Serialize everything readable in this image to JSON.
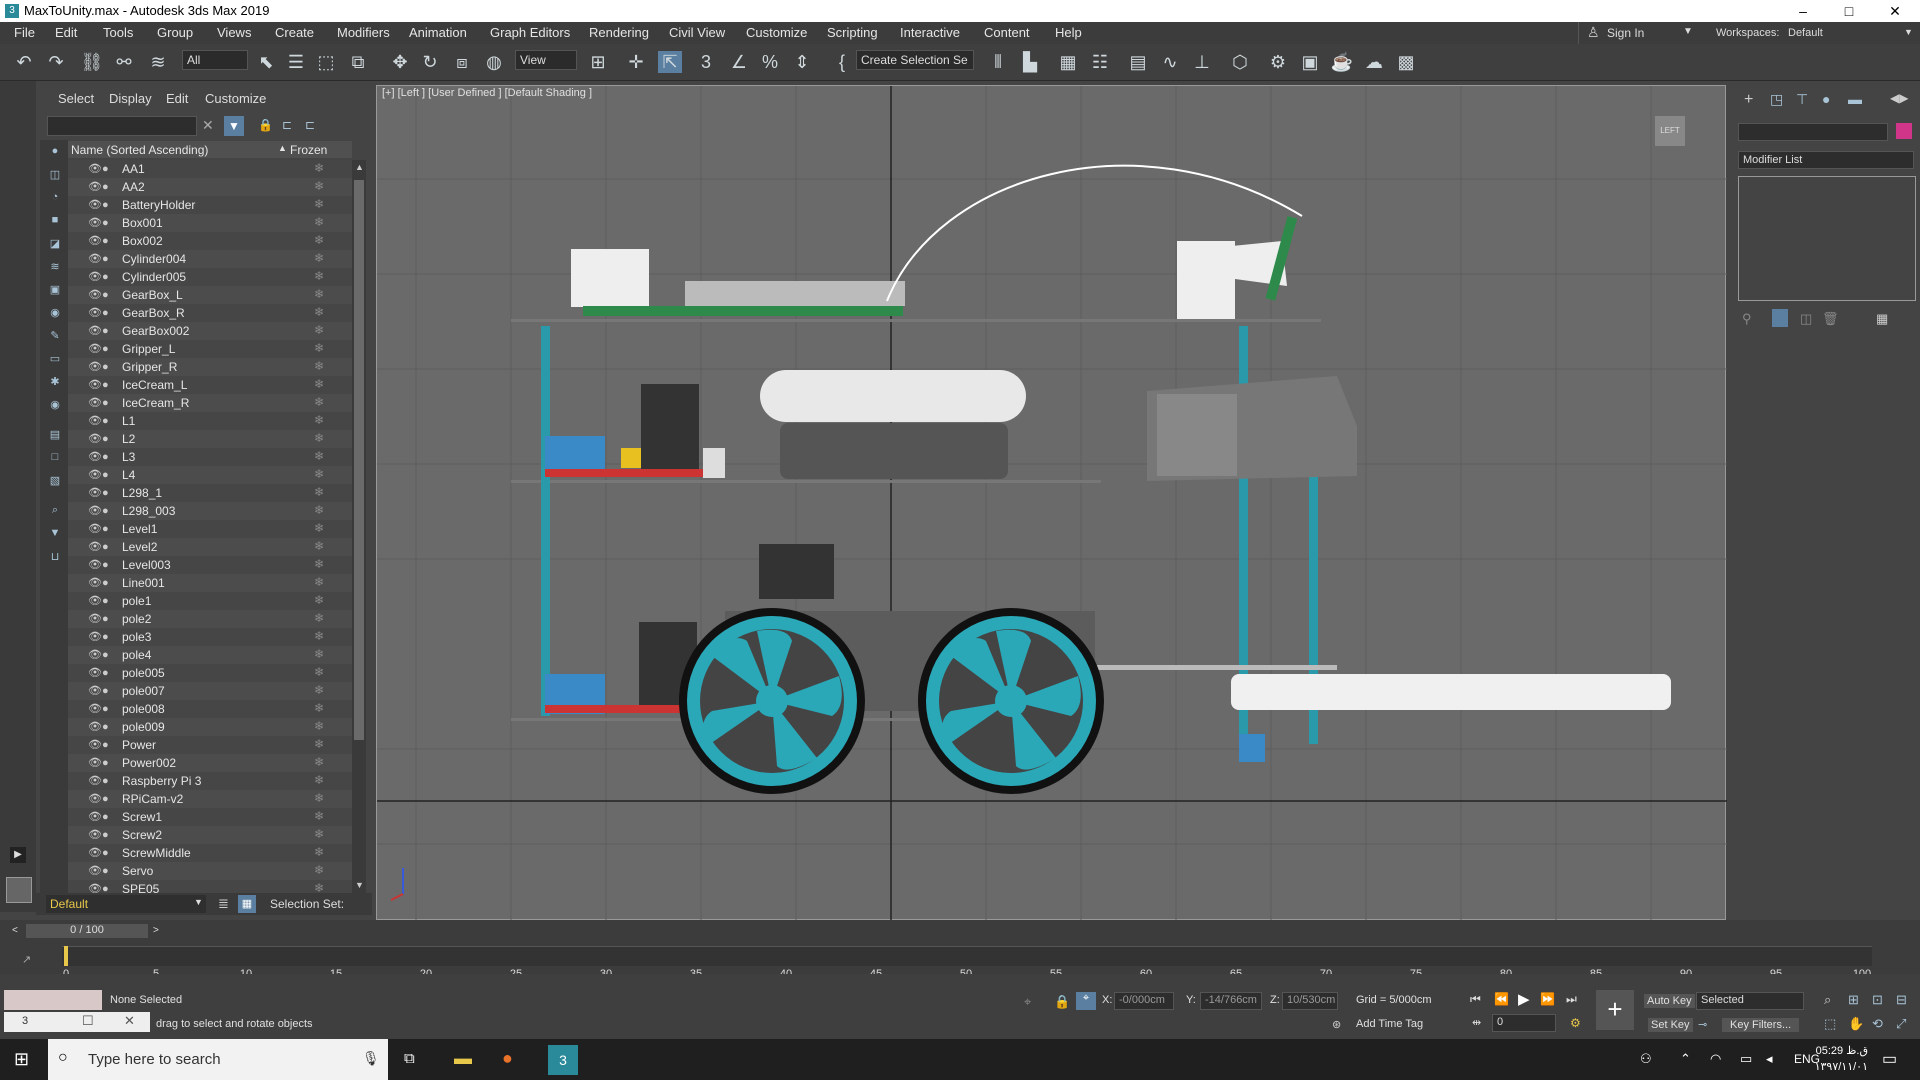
{
  "window": {
    "title": "MaxToUnity.max - Autodesk 3ds Max 2019",
    "min": "–",
    "max": "□",
    "close": "✕"
  },
  "menu": [
    "File",
    "Edit",
    "Tools",
    "Group",
    "Views",
    "Create",
    "Modifiers",
    "Animation",
    "Graph Editors",
    "Rendering",
    "Civil View",
    "Customize",
    "Scripting",
    "Interactive",
    "Content",
    "Help"
  ],
  "signin": "Sign In",
  "workspaces_label": "Workspaces:",
  "workspace": "Default",
  "toolbar": {
    "filter": "All",
    "refcoord": "View",
    "selset": "Create Selection Se"
  },
  "explorer": {
    "tabs": [
      "Select",
      "Display",
      "Edit",
      "Customize"
    ],
    "col_name": "Name (Sorted Ascending)",
    "col_frozen": "Frozen",
    "items": [
      "AA1",
      "AA2",
      "BatteryHolder",
      "Box001",
      "Box002",
      "Cylinder004",
      "Cylinder005",
      "GearBox_L",
      "GearBox_R",
      "GearBox002",
      "Gripper_L",
      "Gripper_R",
      "IceCream_L",
      "IceCream_R",
      "L1",
      "L2",
      "L3",
      "L4",
      "L298_1",
      "L298_003",
      "Level1",
      "Level2",
      "Level003",
      "Line001",
      "pole1",
      "pole2",
      "pole3",
      "pole4",
      "pole005",
      "pole007",
      "pole008",
      "pole009",
      "Power",
      "Power002",
      "Raspberry Pi 3",
      "RPiCam-v2",
      "Screw1",
      "Screw2",
      "ScrewMiddle",
      "Servo",
      "SPE05"
    ],
    "layer": "Default",
    "selection_set": "Selection Set:"
  },
  "viewport": {
    "label": "[+] [Left ] [User Defined ] [Default Shading ]",
    "viewcube": "LEFT"
  },
  "cmd": {
    "modifier_list": "Modifier List"
  },
  "timeline": {
    "frame": "0 / 100",
    "ticks": [
      "0",
      "5",
      "10",
      "15",
      "20",
      "25",
      "30",
      "35",
      "40",
      "45",
      "50",
      "55",
      "60",
      "65",
      "70",
      "75",
      "80",
      "85",
      "90",
      "95",
      "100"
    ]
  },
  "status": {
    "selected": "None Selected",
    "prompt": "drag to select and rotate objects",
    "x_label": "X:",
    "x": "-0/000cm",
    "y_label": "Y:",
    "y": "-14/766cm",
    "z_label": "Z:",
    "z": "10/530cm",
    "grid": "Grid = 5/000cm",
    "add_time_tag": "Add Time Tag",
    "auto_key": "Auto Key",
    "selected_dd": "Selected",
    "set_key": "Set Key",
    "key_filters": "Key Filters...",
    "frame_field": "0"
  },
  "taskbar": {
    "search": "Type here to search",
    "lang": "ENG",
    "time": "05:29 ق.ظ",
    "date": "۱۳۹۷/۱۱/۰۱"
  }
}
